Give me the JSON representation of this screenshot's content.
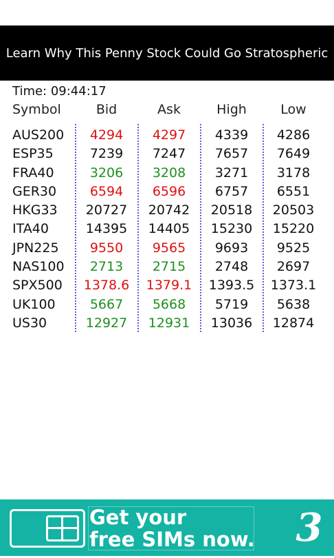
{
  "top_ad": {
    "text": "Learn Why This Penny Stock Could Go Stratospheric"
  },
  "time": {
    "label": "Time: 09:44:17"
  },
  "columns": {
    "symbol": "Symbol",
    "bid": "Bid",
    "ask": "Ask",
    "high": "High",
    "low": "Low"
  },
  "colors": {
    "up": "#1f8f1f",
    "down": "#e01010",
    "separator": "#5b5bd6",
    "ad_bg": "#14b3a4"
  },
  "quotes": [
    {
      "symbol": "AUS200",
      "bid": "4294",
      "ask": "4297",
      "high": "4339",
      "low": "4286",
      "trend": "down"
    },
    {
      "symbol": "ESP35",
      "bid": "7239",
      "ask": "7247",
      "high": "7657",
      "low": "7649",
      "trend": "flat"
    },
    {
      "symbol": "FRA40",
      "bid": "3206",
      "ask": "3208",
      "high": "3271",
      "low": "3178",
      "trend": "up"
    },
    {
      "symbol": "GER30",
      "bid": "6594",
      "ask": "6596",
      "high": "6757",
      "low": "6551",
      "trend": "down"
    },
    {
      "symbol": "HKG33",
      "bid": "20727",
      "ask": "20742",
      "high": "20518",
      "low": "20503",
      "trend": "flat"
    },
    {
      "symbol": "ITA40",
      "bid": "14395",
      "ask": "14405",
      "high": "15230",
      "low": "15220",
      "trend": "flat"
    },
    {
      "symbol": "JPN225",
      "bid": "9550",
      "ask": "9565",
      "high": "9693",
      "low": "9525",
      "trend": "down"
    },
    {
      "symbol": "NAS100",
      "bid": "2713",
      "ask": "2715",
      "high": "2748",
      "low": "2697",
      "trend": "up"
    },
    {
      "symbol": "SPX500",
      "bid": "1378.6",
      "ask": "1379.1",
      "high": "1393.5",
      "low": "1373.1",
      "trend": "down"
    },
    {
      "symbol": "UK100",
      "bid": "5667",
      "ask": "5668",
      "high": "5719",
      "low": "5638",
      "trend": "up"
    },
    {
      "symbol": "US30",
      "bid": "12927",
      "ask": "12931",
      "high": "13036",
      "low": "12874",
      "trend": "up"
    }
  ],
  "bottom_ad": {
    "line1": "Get your",
    "line2": "free SIMs now.",
    "icon": "sim-card-icon",
    "logo": "3"
  }
}
